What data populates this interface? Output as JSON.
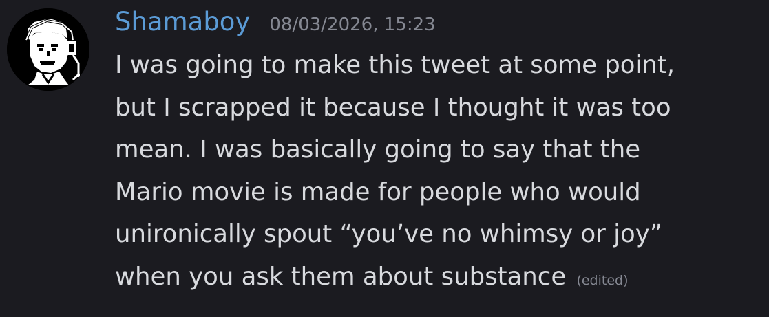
{
  "message": {
    "author": "Shamaboy",
    "timestamp": "08/03/2026, 15:23",
    "lines": [
      "I was going to make this tweet at some point,",
      "but I scrapped it because I thought it was too",
      "mean. I was basically going to say that the",
      "Mario movie is made for people who would",
      "unironically spout “you’ve no whimsy or joy”",
      "when you ask them about substance"
    ],
    "edited_label": "(edited)"
  },
  "colors": {
    "background": "#1b1b20",
    "username": "#5b9bd6",
    "text": "#d8dade",
    "muted": "#858892"
  },
  "icons": {
    "avatar": "pixel-art-face-avatar"
  }
}
